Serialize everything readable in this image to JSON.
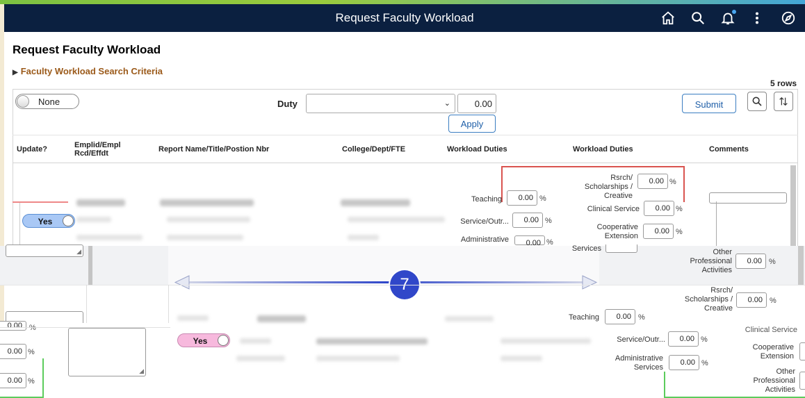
{
  "header": {
    "title": "Request Faculty Workload",
    "icons": [
      "home-icon",
      "search-icon",
      "bell-icon",
      "more-icon",
      "nav-compass-icon"
    ]
  },
  "page": {
    "title": "Request Faculty Workload",
    "search_criteria": "Faculty Workload Search Criteria",
    "rows_count": "5 rows"
  },
  "toolbar": {
    "select_all_toggle": "None",
    "duty_label": "Duty",
    "duty_value": "",
    "duty_amount": "0.00",
    "apply": "Apply",
    "submit": "Submit"
  },
  "columns": [
    "Update?",
    "Emplid/Empl Rcd/Effdt",
    "Report Name/Title/Postion Nbr",
    "College/Dept/FTE",
    "Workload Duties",
    "Workload Duties",
    "Comments"
  ],
  "rows": [
    {
      "update": "Yes",
      "duties_a": [
        {
          "label": "Teaching",
          "value": "0.00"
        },
        {
          "label": "Service/Outr...",
          "value": "0.00"
        },
        {
          "label": "Administrative",
          "value": "0.00"
        }
      ],
      "duties_b": [
        {
          "label": "Rsrch/ Scholarships / Creative",
          "value": "0.00"
        },
        {
          "label": "Clinical Service",
          "value": "0.00"
        },
        {
          "label": "Cooperative Extension",
          "value": "0.00"
        },
        {
          "label": "Services",
          "value": ""
        },
        {
          "label": "Other Professional Activities",
          "value": "0.00"
        }
      ]
    },
    {
      "update": "Yes",
      "left_values": [
        "0.00",
        "0.00",
        "0.00"
      ],
      "duties_a": [
        {
          "label": "Teaching",
          "value": "0.00"
        },
        {
          "label": "Service/Outr...",
          "value": "0.00"
        },
        {
          "label": "Administrative Services",
          "value": "0.00"
        }
      ],
      "duties_b": [
        {
          "label": "Rsrch/ Scholarships / Creative",
          "value": "0.00"
        },
        {
          "label": "Clinical Service",
          "value": ""
        },
        {
          "label": "Cooperative Extension",
          "value": ""
        },
        {
          "label": "Other Professional Activities",
          "value": ""
        }
      ]
    }
  ],
  "pct_symbol": "%",
  "annotation": {
    "step": "7"
  },
  "colors": {
    "header_bg": "#0b2040",
    "link_brown": "#9b5a1a",
    "yes_blue": "#a9c8f5",
    "yes_pink": "#f7b9dd",
    "highlight_red": "#d9534f",
    "highlight_green": "#5ccc5c",
    "step_badge": "#3047c9"
  }
}
